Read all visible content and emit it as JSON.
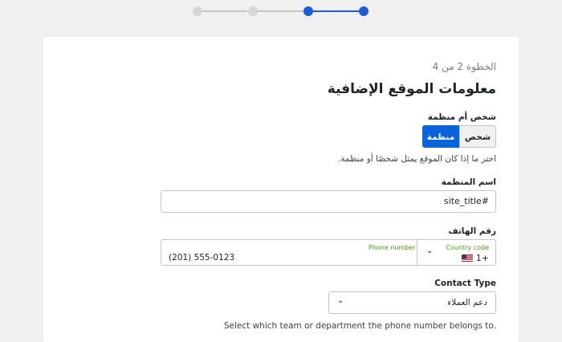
{
  "stepper": {
    "total": 4,
    "current": 2
  },
  "form": {
    "step_counter": "الخطوة 2 من 4",
    "title": "معلومات الموقع الإضافية",
    "entity_type": {
      "label": "شخص أم منظمة",
      "options": [
        "شخص",
        "منظمة"
      ],
      "selected": "منظمة",
      "help": "اختر ما إذا كان الموقع يمثل شخصًا أو منظمة."
    },
    "org_name": {
      "label": "اسم المنظمة",
      "value": "#site_title"
    },
    "phone": {
      "label": "رقم الهاتف",
      "country_label": "Country code",
      "country_value": "1+",
      "number_label": "Phone number",
      "number_value": "(201) 555-0123"
    },
    "contact_type": {
      "label": "Contact Type",
      "value": "دعم العملاء",
      "help": "Select which team or department the phone number belongs to."
    }
  },
  "colors": {
    "accent": "#0a63d8",
    "green_label": "#4a9a14"
  }
}
